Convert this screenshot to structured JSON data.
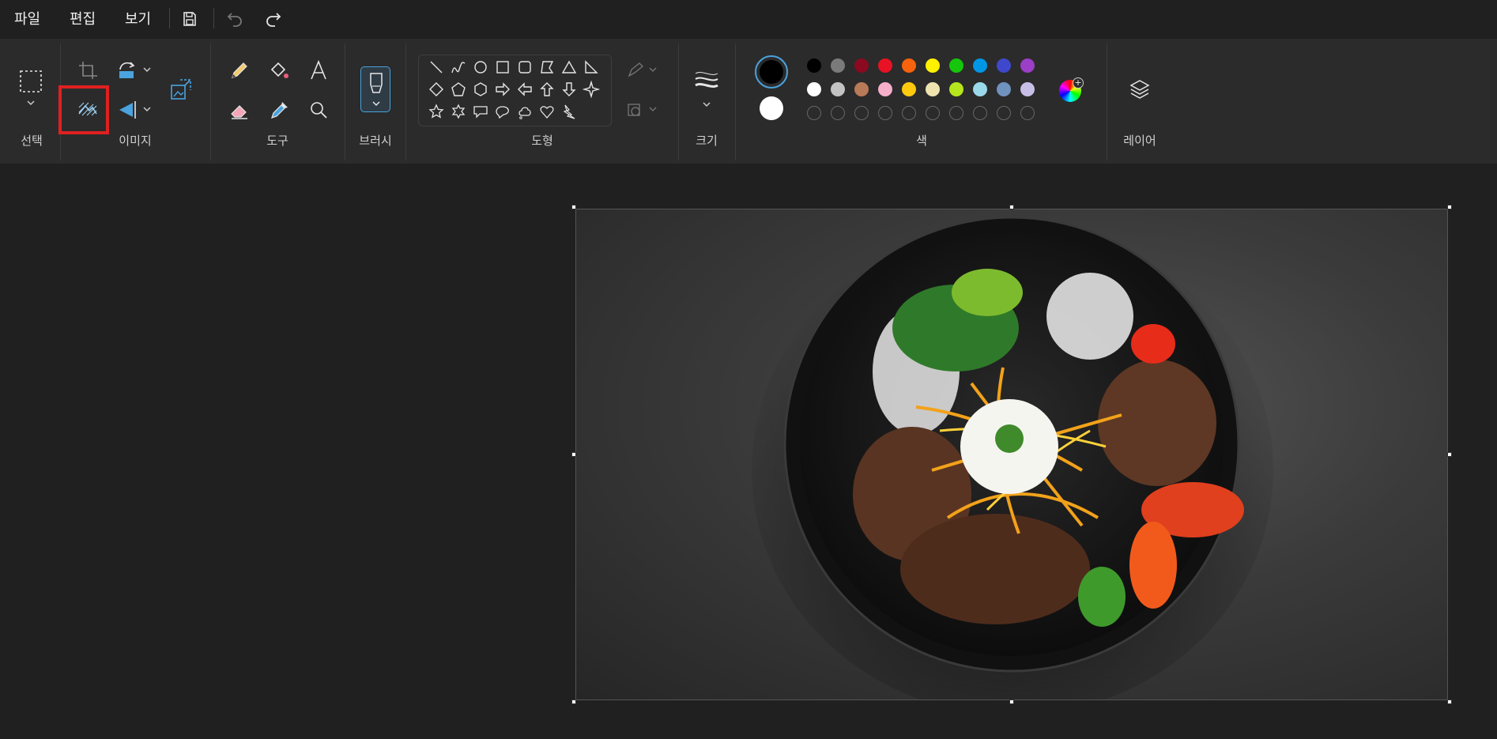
{
  "menu": {
    "file": "파일",
    "edit": "편집",
    "view": "보기"
  },
  "ribbon": {
    "groups": {
      "select": "선택",
      "image": "이미지",
      "tools": "도구",
      "brush": "브러시",
      "shapes": "도형",
      "size": "크기",
      "color": "색",
      "layers": "레이어"
    }
  },
  "colors": {
    "accent": "#4aa3df",
    "highlight_box": "#e02020",
    "primary_color": "#000000",
    "secondary_color": "#ffffff",
    "palette_row1": [
      "#000000",
      "#7a7a7a",
      "#8b0a1f",
      "#e81224",
      "#f7630c",
      "#fff100",
      "#16c60c",
      "#0096e6",
      "#3f48cc",
      "#9b3fc6"
    ],
    "palette_row2": [
      "#ffffff",
      "#c3c3c3",
      "#b97a57",
      "#f7aec8",
      "#ffc90e",
      "#efe4b0",
      "#b5e61d",
      "#99d9ea",
      "#7092be",
      "#c8bfe7"
    ]
  },
  "icons": {
    "select": "rect-select-icon",
    "crop": "crop-icon",
    "rotate": "rotate-icon",
    "flip": "flip-icon",
    "remove_background": "remove-background-icon",
    "resize": "resize-image-icon",
    "pencil": "pencil-icon",
    "fill": "fill-bucket-icon",
    "text": "text-icon",
    "eraser": "eraser-icon",
    "color_picker": "color-picker-icon",
    "magnifier": "magnifier-icon",
    "layers": "layers-icon"
  },
  "canvas": {
    "image_description": "bibimbap-style bowl photo"
  }
}
